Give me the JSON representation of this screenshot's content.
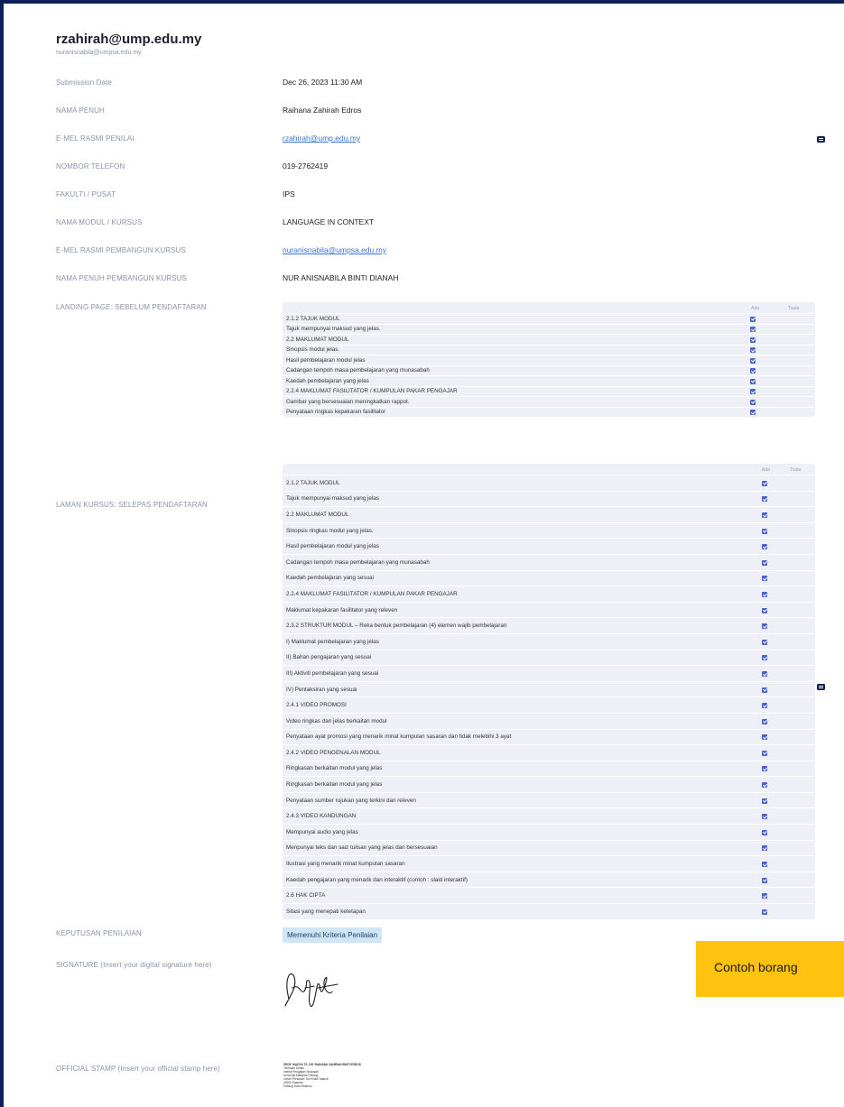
{
  "header": {
    "title_email": "rzahirah@ump.edu.my",
    "sub_email": "nuranisnabila@umpsa.edu.my"
  },
  "fields": [
    {
      "label": "Submission Date",
      "value": "Dec 26, 2023 11:30 AM"
    },
    {
      "label": "NAMA PENUH",
      "value": "Raihana Zahirah Edros"
    },
    {
      "label": "E-MEL RASMI PENILAI",
      "value": "rzahirah@ump.edu.my"
    },
    {
      "label": "NOMBOR TELEFON",
      "value": "019-2762419"
    },
    {
      "label": "FAKULTI / PUSAT",
      "value": "IPS"
    },
    {
      "label": "NAMA MODUL / KURSUS",
      "value": "LANGUAGE IN CONTEXT"
    },
    {
      "label": "E-MEL RASMI PEMBANGUN KURSUS",
      "value": "nuranisnabila@umpsa.edu.my"
    },
    {
      "label": "NAMA PENUH PEMBANGUN KURSUS",
      "value": "NUR ANISNABILA BINTI DIANAH"
    }
  ],
  "landing": {
    "label": "LANDING PAGE: SEBELUM PENDAFTARAN",
    "col_yes": "Ada",
    "col_no": "Tiada",
    "rows": [
      "2.1.2 TAJUK MODUL",
      "Tajuk mempunyai maksud yang jelas.",
      "2.2 MAKLUMAT MODUL",
      "Sinopsis modul jelas.",
      "Hasil pembelajaran modul jelas",
      "Cadangan tempoh masa pembelajaran yang munasabah",
      "Kaedah pembelajaran yang jelas",
      "2.2.4 MAKLUMAT FASILITATOR / KUMPULAN PAKAR PENGAJAR",
      "Gambar yang bersesuaian meningkatkan rappot.",
      "Penyataan ringkas kepakaran fasilitator"
    ]
  },
  "laman": {
    "label": "LAMAN KURSUS: SELEPAS PENDAFTARAN",
    "col_yes": "Ada",
    "col_no": "Tiada",
    "rows": [
      "2.1.2 TAJUK MODUL",
      "Tajuk mempunyai maksud yang jelas",
      "2.2 MAKLUMAT MODUL",
      "Sinopsis ringkas modul yang jelas.",
      "Hasil pembelajaran modul yang jelas",
      "Cadangan tempoh masa pembelajaran yang munasabah",
      "Kaedah pembelajaran yang sesuai",
      "2.2.4 MAKLUMAT FASILITATOR / KUMPULAN PAKAR PENGAJAR",
      "Maklumat kepakaran fasilitator yang releven",
      "2.3.2 STRUKTUR MODUL – Reka bentuk pembelajaran (4) elemen wajib pembelajaran",
      "I) Maklumat pembelajaran yang jelas",
      "II) Bahan pengajaran yang sesuai",
      "III) Aktiviti pembelajaran yang sesuai",
      "IV) Pentaksiran yang sesuai",
      "2.4.1 VIDEO PROMOSI",
      "Video ringkas dan jelas berkaitan modul",
      "Penyataan ayat promosi yang menarik minat kumpulan sasaran dan tidak melebihi 3 ayat",
      "2.4.2 VIDEO PENGENALAN MODUL",
      "Ringkasan berkaitan modul yang jelas",
      "Ringkasan berkaitan modul yang jelas",
      "Penyataan sumber rujukan yang terkini dan releven",
      "2.4.3 VIDEO KANDUNGAN",
      "Mempunyai audio yang jelas",
      "Menpunyai teks dan saiz tulisan yang jelas dan bersesuaian",
      "Ilustrasi yang menarik minat kumpulan sasaran",
      "Kaedah pengajaran yang menarik dan interaktif (contoh : slaid interaktif)",
      "2.6 HAK CIPTA",
      "Sitasi yang menepati ketetapan"
    ]
  },
  "keputusan": {
    "label": "KEPUTUSAN PENILAIAN",
    "value": "Memenuhi Kriteria Penilaian"
  },
  "signature": {
    "label": "SIGNATURE (Insert your digital signature here)"
  },
  "stamp": {
    "label": "OFFICIAL STAMP (Insert your official stamp here)",
    "lines": [
      "PROF. MADYA TS. DR. RAIHANA ZAHIRAH BINTI EDROS",
      "Timbalan Dekan",
      "Institut Pengajian Siswazah",
      "Universiti Malaysia Pahang",
      "Lebuh Persiaran Tun Khalil Yaakob",
      "26300 Kuantan",
      "Pahang Darul Makmur"
    ]
  },
  "callout": {
    "text": "Contoh borang"
  }
}
